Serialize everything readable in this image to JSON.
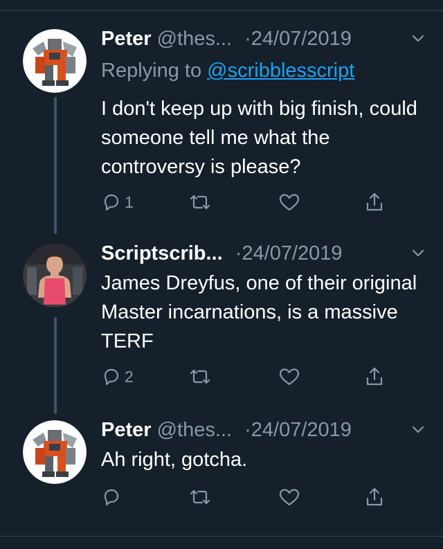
{
  "tweets": [
    {
      "name": "Peter",
      "handle": "@thes...",
      "separator": "·",
      "date": "24/07/2019",
      "avatar": "robot-avatar",
      "replying_prefix": "Replying to",
      "replying_to": "@scribblesscript",
      "text": "I don't keep up with big finish, could someone tell me what the controversy is please?",
      "reply_count": "1",
      "icons": [
        "reply-icon",
        "retweet-icon",
        "like-icon",
        "share-icon",
        "chevron-down-icon"
      ]
    },
    {
      "name": "Scriptscrib...",
      "handle": "",
      "separator": "·",
      "date": "24/07/2019",
      "avatar": "person-avatar",
      "text": "James Dreyfus, one of their original Master incarnations, is a massive TERF",
      "reply_count": "2",
      "icons": [
        "reply-icon",
        "retweet-icon",
        "like-icon",
        "share-icon",
        "chevron-down-icon"
      ]
    },
    {
      "name": "Peter",
      "handle": "@thes...",
      "separator": "·",
      "date": "24/07/2019",
      "avatar": "robot-avatar",
      "text": "Ah right, gotcha.",
      "reply_count": "",
      "icons": [
        "reply-icon",
        "retweet-icon",
        "like-icon",
        "share-icon",
        "chevron-down-icon"
      ]
    }
  ],
  "colors": {
    "background": "#15202b",
    "secondary_text": "#8899a6",
    "link": "#1da1f2",
    "thread_line": "#3d5466",
    "divider": "#38444d"
  }
}
